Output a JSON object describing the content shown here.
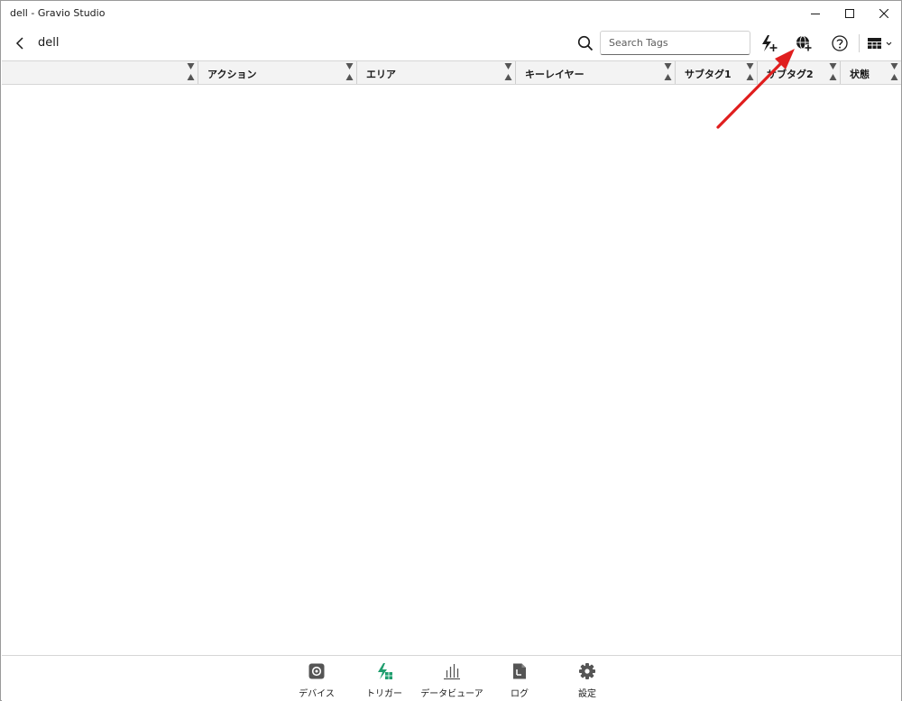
{
  "window": {
    "title": "dell - Gravio Studio"
  },
  "toolbar": {
    "breadcrumb": "dell",
    "search_placeholder": "Search Tags",
    "search_value": ""
  },
  "table": {
    "columns": [
      {
        "label": ""
      },
      {
        "label": "アクション"
      },
      {
        "label": "エリア"
      },
      {
        "label": "キーレイヤー"
      },
      {
        "label": "サブタグ1"
      },
      {
        "label": "サブタグ2"
      },
      {
        "label": "状態"
      }
    ],
    "rows": []
  },
  "bottom_nav": {
    "items": [
      {
        "label": "デバイス",
        "icon": "device-icon"
      },
      {
        "label": "トリガー",
        "icon": "trigger-icon",
        "active": true
      },
      {
        "label": "データビューア",
        "icon": "chart-icon"
      },
      {
        "label": "ログ",
        "icon": "log-icon"
      },
      {
        "label": "設定",
        "icon": "gear-icon"
      }
    ]
  },
  "colors": {
    "accent": "#1f9e6e",
    "annotation_arrow": "#e01e1e",
    "header_bg": "#f3f3f3"
  }
}
